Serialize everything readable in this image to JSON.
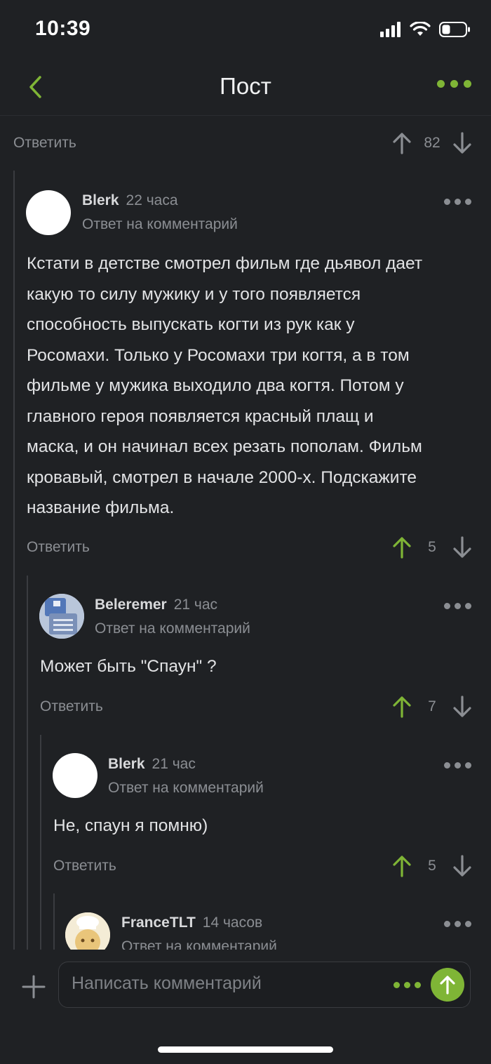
{
  "status": {
    "time": "10:39"
  },
  "nav": {
    "title": "Пост"
  },
  "top_reply": {
    "reply_label": "Ответить",
    "votes": "82"
  },
  "comments": [
    {
      "author": "Blerk",
      "time": "22 часа",
      "meta": "Ответ на комментарий",
      "lines": [
        "Кстати в детстве смотрел фильм где дьявол дает",
        "какую то силу мужику и у того появляется",
        "способность выпускать когти из рук как у",
        "Росомахи. Только у Росомахи три когтя, а в том",
        "фильме у мужика выходило два когтя. Потом у",
        "главного героя появляется красный плащ и",
        "маска, и он начинал всех резать пополам. Фильм",
        "кровавый, смотрел в начале 2000-х. Подскажите",
        "название фильма."
      ],
      "reply_label": "Ответить",
      "votes": "5"
    },
    {
      "author": "Beleremer",
      "time": "21 час",
      "meta": "Ответ на комментарий",
      "text": "Может быть \"Спаун\" ?",
      "reply_label": "Ответить",
      "votes": "7"
    },
    {
      "author": "Blerk",
      "time": "21 час",
      "meta": "Ответ на комментарий",
      "text": "Не, спаун я помню)",
      "reply_label": "Ответить",
      "votes": "5"
    },
    {
      "author": "FranceTLT",
      "time": "14 часов",
      "meta": "Ответ на комментарий"
    }
  ],
  "composer": {
    "placeholder": "Написать комментарий"
  },
  "colors": {
    "accent": "#7fb536",
    "background": "#1f2124",
    "muted": "#8b8e93"
  }
}
